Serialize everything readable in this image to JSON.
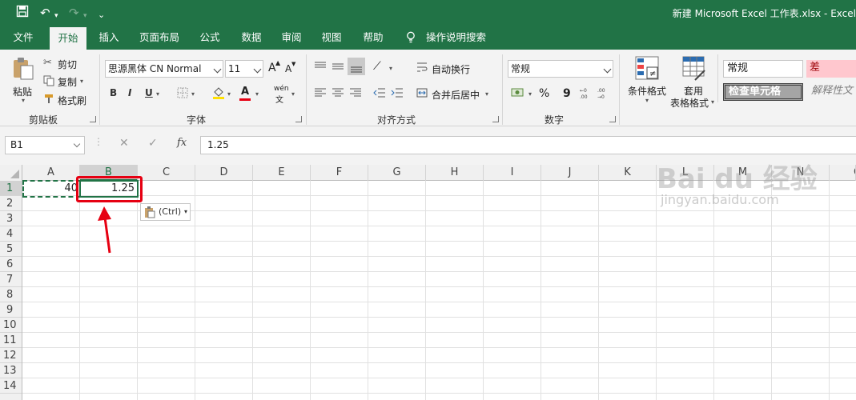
{
  "window": {
    "title": "新建 Microsoft Excel 工作表.xlsx  -  Excel"
  },
  "tabs": [
    "文件",
    "开始",
    "插入",
    "页面布局",
    "公式",
    "数据",
    "审阅",
    "视图",
    "帮助"
  ],
  "tell_me": "操作说明搜索",
  "ribbon": {
    "clipboard": {
      "paste": "粘贴",
      "cut": "剪切",
      "copy": "复制",
      "format_painter": "格式刷",
      "label": "剪贴板"
    },
    "font": {
      "name": "思源黑体 CN Normal",
      "size": "11",
      "grow": "A",
      "shrink": "A",
      "bold": "B",
      "italic": "I",
      "underline": "U",
      "font_color_letter": "A",
      "phonetic": "wén",
      "label": "字体"
    },
    "alignment": {
      "wrap": "自动换行",
      "merge": "合并后居中",
      "label": "对齐方式"
    },
    "number": {
      "format": "常规",
      "percent": "%",
      "comma": "9",
      "label": "数字"
    },
    "styles": {
      "conditional": "条件格式",
      "table_line1": "套用",
      "table_line2": "表格格式",
      "normal": "常规",
      "bad": "差",
      "check_cell": "检查单元格",
      "explanatory": "解释性文"
    }
  },
  "formula_bar": {
    "name_box": "B1",
    "content": "1.25",
    "fx": "fx",
    "cancel": "✕",
    "enter": "✓"
  },
  "columns": [
    "A",
    "B",
    "C",
    "D",
    "E",
    "F",
    "G",
    "H",
    "I",
    "J",
    "K",
    "L",
    "M",
    "N",
    "O"
  ],
  "rows": [
    "1",
    "2",
    "3",
    "4",
    "5",
    "6",
    "7",
    "8",
    "9",
    "10",
    "11",
    "12",
    "13",
    "14"
  ],
  "cells": {
    "A1": "40",
    "B1": "1.25"
  },
  "paste_options": "(Ctrl)",
  "watermark": {
    "line1": "Bai du 经验",
    "line2": "jingyan.baidu.com"
  },
  "colors": {
    "excel_green": "#217346",
    "highlight_red": "#e60012",
    "bad_fill": "#ffc7ce"
  }
}
